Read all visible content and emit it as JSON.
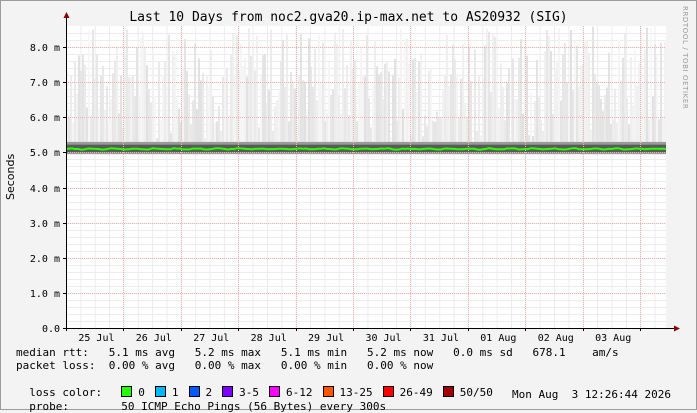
{
  "chart_data": {
    "type": "area",
    "title": "Last 10 Days from noc2.gva20.ip-max.net to AS20932 (SIG)",
    "ylabel": "Seconds",
    "watermark": "RRDTOOL / TOBI OETIKER",
    "y_ticks": [
      "0.0",
      "1.0 m",
      "2.0 m",
      "3.0 m",
      "4.0 m",
      "5.0 m",
      "6.0 m",
      "7.0 m",
      "8.0 m"
    ],
    "y_tick_values": [
      0,
      1,
      2,
      3,
      4,
      5,
      6,
      7,
      8
    ],
    "ylim": [
      0,
      8.6
    ],
    "x_ticks": [
      "25 Jul",
      "26 Jul",
      "27 Jul",
      "28 Jul",
      "29 Jul",
      "30 Jul",
      "31 Jul",
      "01 Aug",
      "02 Aug",
      "03 Aug"
    ],
    "xlim": [
      0,
      10.45
    ],
    "x_tick_positions": [
      0.53,
      1.53,
      2.53,
      3.53,
      4.53,
      5.53,
      6.53,
      7.53,
      8.53,
      9.53
    ],
    "grid": true,
    "median_rtt_ms": 5.1,
    "smoke_band_ms": [
      4.95,
      5.3
    ],
    "smoke_max_ms": 8.6
  },
  "legend": {
    "median_rtt": "median rtt:   5.1 ms avg   5.2 ms max   5.1 ms min   5.2 ms now   0.0 ms sd   678.1    am/s",
    "packet_loss": "packet loss:  0.00 % avg   0.00 % max   0.00 % min   0.00 % now",
    "loss_color_label": "loss color:",
    "loss_colors": [
      {
        "label": "0",
        "color": "#26ff00"
      },
      {
        "label": "1",
        "color": "#00b8ff"
      },
      {
        "label": "2",
        "color": "#0059ff"
      },
      {
        "label": "3-5",
        "color": "#7e00ff"
      },
      {
        "label": "6-12",
        "color": "#ff00ff"
      },
      {
        "label": "13-25",
        "color": "#ff5500"
      },
      {
        "label": "26-49",
        "color": "#ff0000"
      },
      {
        "label": "50/50",
        "color": "#a10000"
      }
    ],
    "probe_label": "probe:",
    "probe_text": "50 ICMP Echo Pings (56 Bytes) every 300s",
    "timestamp": "Mon Aug  3 12:26:44 2026"
  },
  "colors": {
    "plot_bg": "#ffffff",
    "grid_minor": "#ececec",
    "grid_major": "#f2b2b2",
    "median_line": "#26ff00",
    "smoke": "#d9d9d9",
    "axis": "#000000"
  }
}
